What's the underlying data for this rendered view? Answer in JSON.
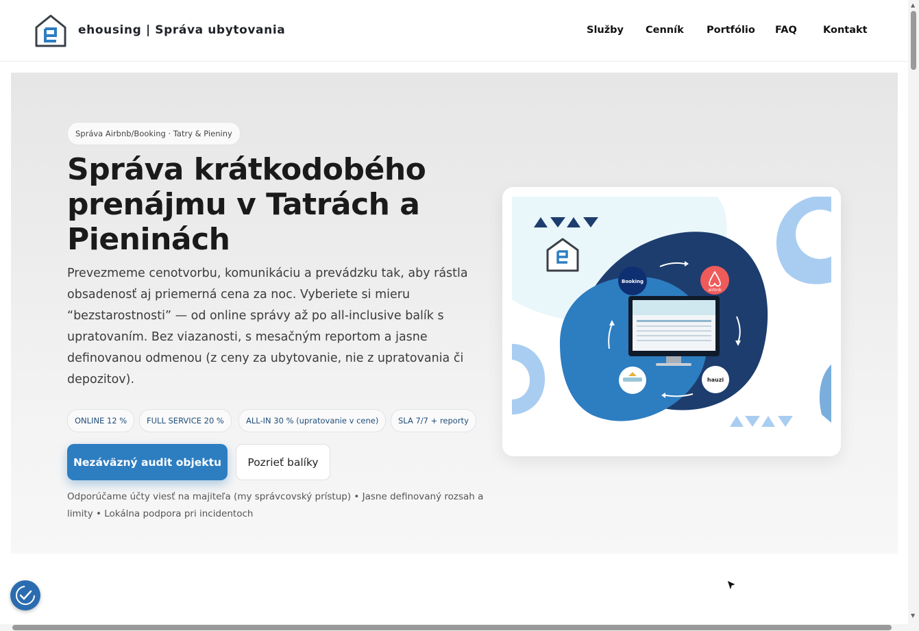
{
  "header": {
    "brand": "ehousing | Správa ubytovania",
    "nav": [
      "Služby",
      "Cenník",
      "Portfólio",
      "FAQ",
      "Kontakt"
    ]
  },
  "hero": {
    "tag": "Správa Airbnb/Booking · Tatry & Pieniny",
    "title": "Správa krátkodobého prenájmu v Tatrách a Pieninách",
    "description": "Prevezmeme cenotvorbu, komunikáciu a prevádzku tak, aby rástla obsadenosť aj priemerná cena za noc. Vyberiete si mieru “bezstarostnosti” — od online správy až po all-inclusive balík s upratovaním. Bez viazanosti, s mesačným reportom a jasne definovanou odmenou (z ceny za ubytovanie, nie z upratovania či depozitov).",
    "chips": [
      "ONLINE 12 %",
      "FULL SERVICE 20 %",
      "ALL-IN 30 % (upratovanie v cene)",
      "SLA 7/7 + reporty"
    ],
    "primary_button": "Nezáväzný audit objektu",
    "secondary_button": "Pozrieť balíky",
    "note": "Odporúčame účty viesť na majiteľa (my správcovský prístup) • Jasne definovaný rozsah a limity • Lokálna podpora pri incidentoch"
  },
  "illustration": {
    "booking_label": "Booking",
    "airbnb_label": "airbnb",
    "hauzi_label": "hauzi"
  },
  "colors": {
    "accent": "#2d7dc1",
    "navy": "#1d3d6e",
    "light_blue": "#a9cdf1"
  }
}
